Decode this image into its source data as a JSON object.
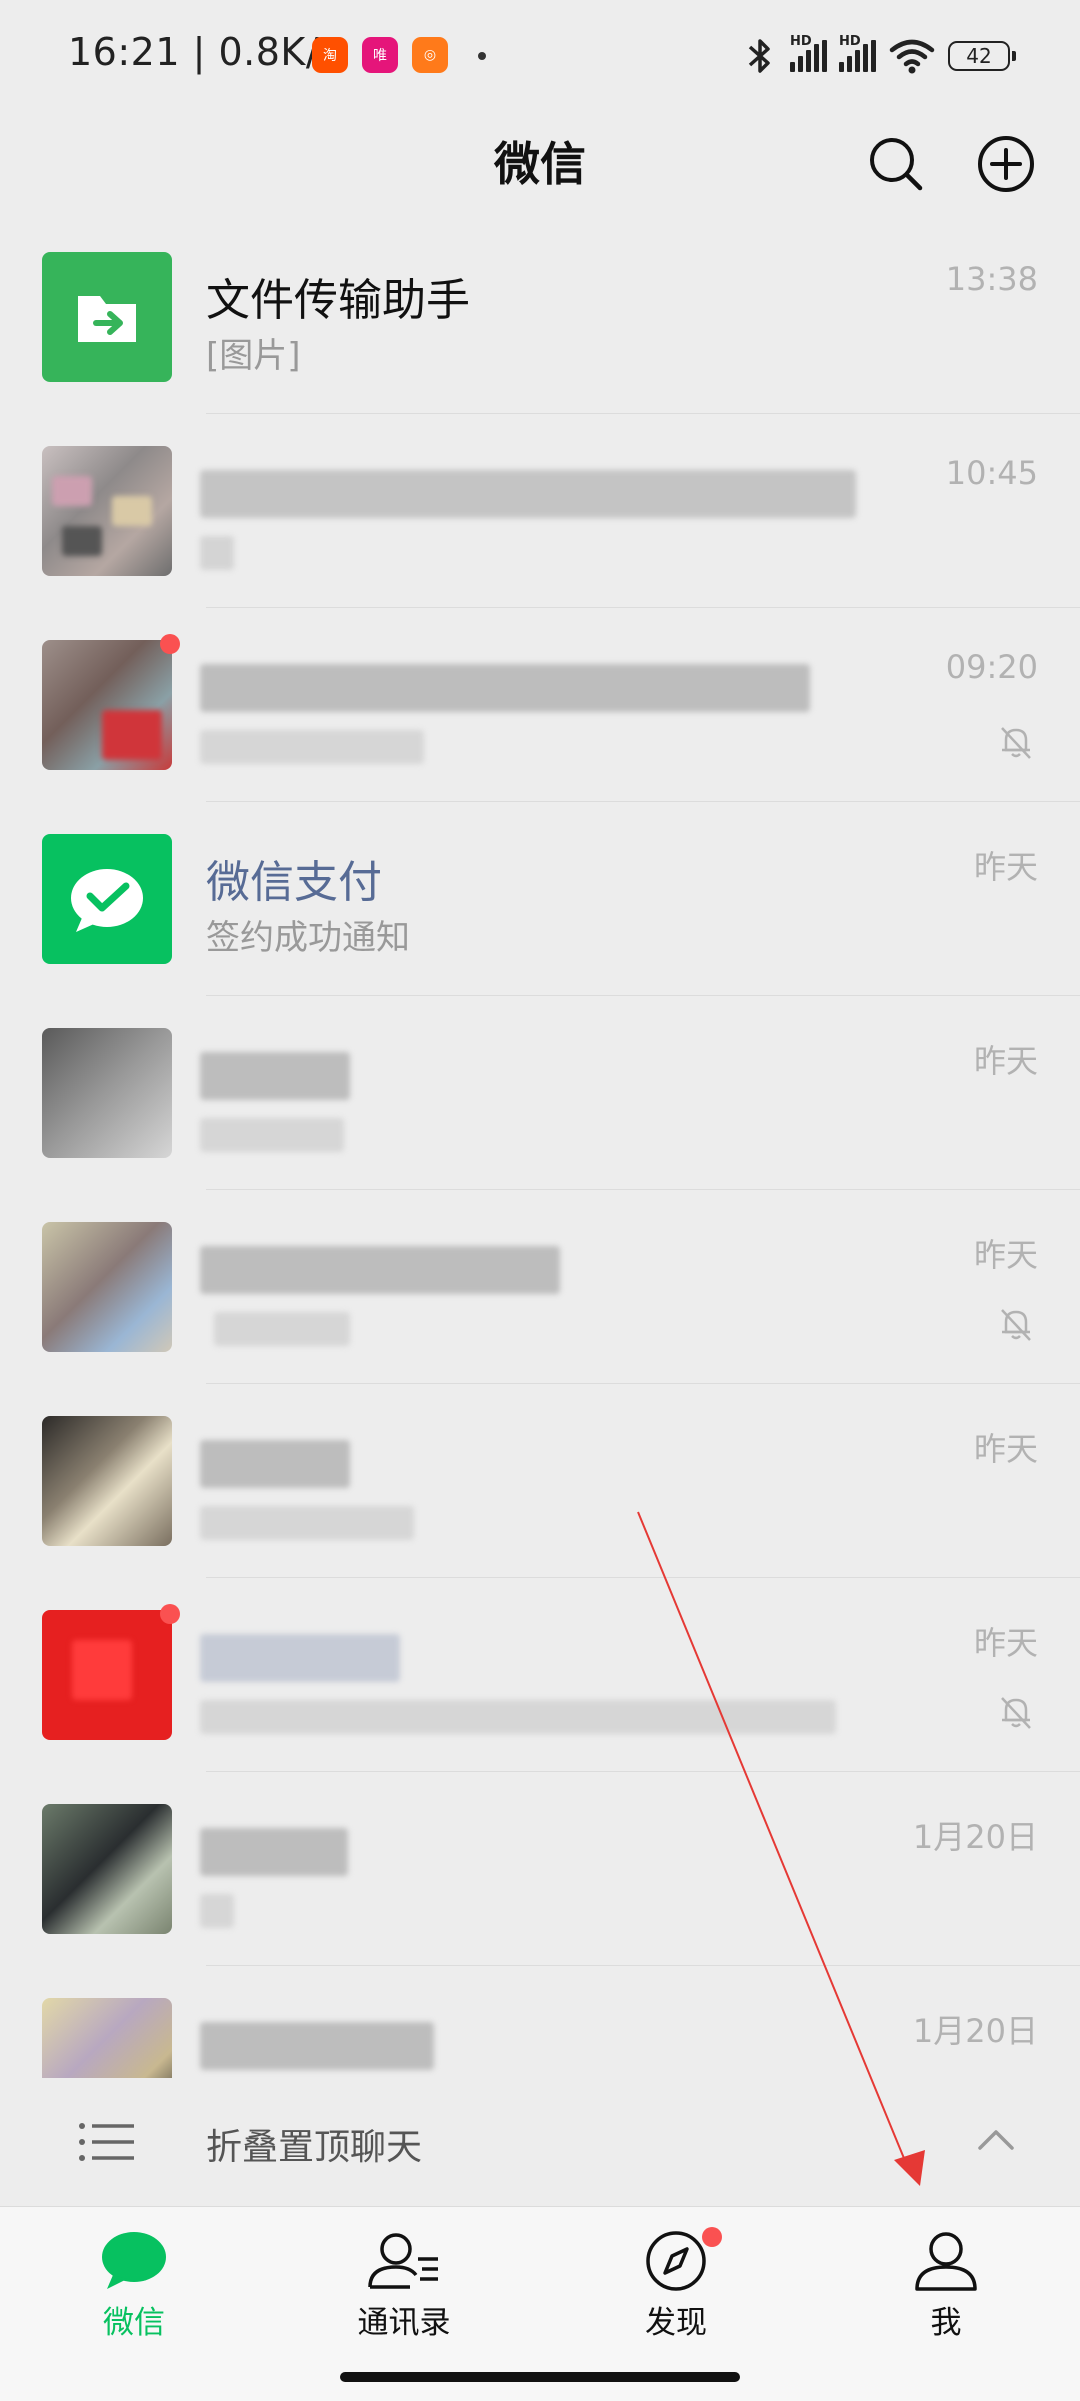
{
  "status_bar": {
    "time": "16:21 | 0.8K/s",
    "app_icons": [
      "taobao-app-icon",
      "vipshop-app-icon",
      "orange-app-icon"
    ],
    "hd_label": "HD",
    "battery": "42"
  },
  "header": {
    "title": "微信",
    "search_icon": "search-icon",
    "add_icon": "add-circle-icon"
  },
  "chats": [
    {
      "name": "文件传输助手",
      "message": "[图片]",
      "time": "13:38",
      "muted": false,
      "avatar": "file-transfer-icon"
    },
    {
      "name": "",
      "message": "",
      "time": "10:45",
      "muted": false,
      "avatar": "blurred-avatar"
    },
    {
      "name": "",
      "message": "",
      "time": "09:20",
      "muted": true,
      "avatar": "blurred-avatar"
    },
    {
      "name": "微信支付",
      "message": "签约成功通知",
      "time": "昨天",
      "muted": false,
      "avatar": "wechat-pay-icon"
    },
    {
      "name": "",
      "message": "",
      "time": "昨天",
      "muted": false,
      "avatar": "blurred-avatar"
    },
    {
      "name": "",
      "message": "",
      "time": "昨天",
      "muted": true,
      "avatar": "blurred-avatar"
    },
    {
      "name": "",
      "message": "",
      "time": "昨天",
      "muted": false,
      "avatar": "blurred-avatar"
    },
    {
      "name": "",
      "message": "",
      "time": "昨天",
      "muted": true,
      "avatar": "blurred-avatar"
    },
    {
      "name": "",
      "message": "",
      "time": "1月20日",
      "muted": false,
      "avatar": "blurred-avatar"
    },
    {
      "name": "",
      "message": "",
      "time": "1月20日",
      "muted": false,
      "avatar": "blurred-avatar"
    }
  ],
  "fold_pinned": {
    "label": "折叠置顶聊天"
  },
  "bottom_nav": [
    {
      "label": "微信",
      "icon": "chat-bubble-icon",
      "active": true
    },
    {
      "label": "通讯录",
      "icon": "contacts-icon",
      "active": false
    },
    {
      "label": "发现",
      "icon": "compass-icon",
      "active": false,
      "badge": true
    },
    {
      "label": "我",
      "icon": "person-icon",
      "active": false
    }
  ],
  "colors": {
    "brand_green": "#07c160",
    "official_name": "#576b95",
    "badge_red": "#fa5151",
    "annotation_arrow": "#e53935"
  }
}
